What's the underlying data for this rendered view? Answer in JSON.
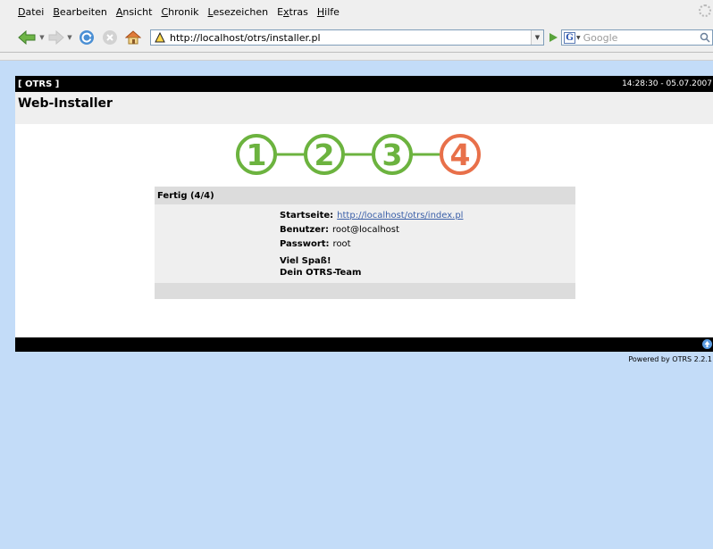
{
  "browser": {
    "menu": [
      "Datei",
      "Bearbeiten",
      "Ansicht",
      "Chronik",
      "Lesezeichen",
      "Extras",
      "Hilfe"
    ],
    "url": "http://localhost/otrs/installer.pl",
    "search_placeholder": "Google"
  },
  "otrs": {
    "brand": "[ OTRS ]",
    "clock": "14:28:30 - 05.07.2007",
    "page_title": "Web-Installer",
    "steps": [
      "1",
      "2",
      "3",
      "4"
    ],
    "step_colors": {
      "done": "#6cb33f",
      "current": "#e8704a"
    },
    "panel": {
      "title": "Fertig (4/4)",
      "start_label": "Startseite:",
      "start_link": "http://localhost/otrs/index.pl",
      "user_label": "Benutzer:",
      "user_value": "root@localhost",
      "pass_label": "Passwort:",
      "pass_value": "root",
      "greeting_line1": "Viel Spaß!",
      "greeting_line2": "Dein OTRS-Team"
    },
    "powered": "Powered by OTRS 2.2.1"
  },
  "icons": [
    "back-arrow-icon",
    "forward-arrow-icon",
    "reload-icon",
    "stop-icon",
    "home-icon",
    "site-icon",
    "go-icon",
    "google-icon",
    "search-icon",
    "throbber-icon",
    "go-up-icon"
  ]
}
